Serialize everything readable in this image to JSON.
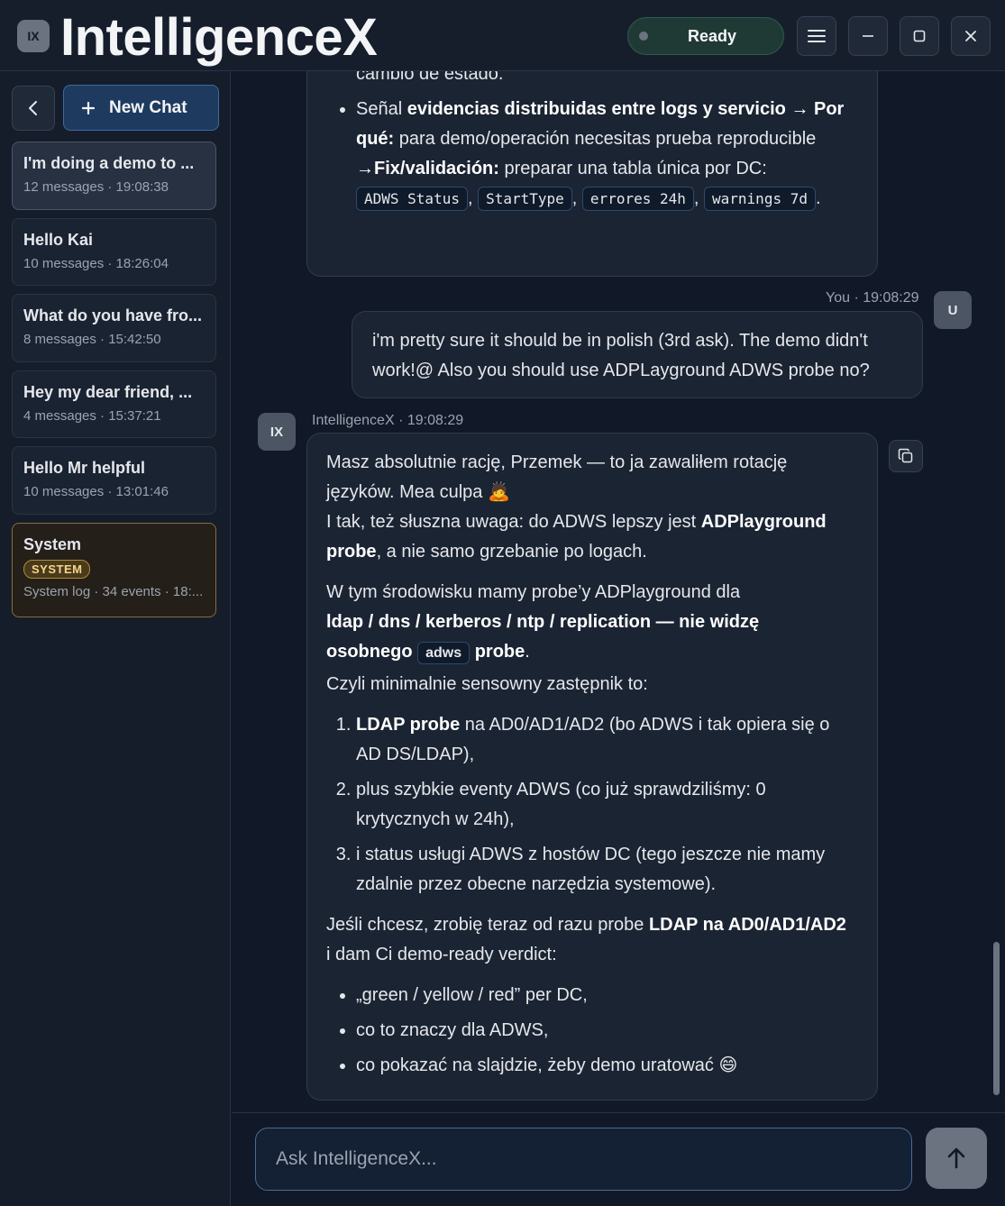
{
  "app": {
    "badge": "IX",
    "title": "IntelligenceX",
    "status": "Ready"
  },
  "sidebar": {
    "new_chat_label": "New Chat",
    "chats": [
      {
        "title": "I'm doing a demo to ...",
        "meta": "12 messages · 19:08:38"
      },
      {
        "title": "Hello Kai",
        "meta": "10 messages · 18:26:04"
      },
      {
        "title": "What do you have fro...",
        "meta": "8 messages · 15:42:50"
      },
      {
        "title": "Hey my dear friend, ...",
        "meta": "4 messages · 15:37:21"
      },
      {
        "title": "Hello Mr helpful",
        "meta": "10 messages · 13:01:46"
      },
      {
        "title": "System",
        "badge": "SYSTEM",
        "meta": "System log · 34 events · 18:..."
      }
    ]
  },
  "messages": {
    "prev_bot": {
      "line1": "min) de estado de servicio + evento ADWS y alertar en cambio de estado.",
      "bullet_pre": "Señal ",
      "bullet_b1": "evidencias distribuidas entre logs y servicio → Por qué:",
      "bullet_mid": " para demo/operación necesitas prueba reproducible ",
      "bullet_b2": "→Fix/validación:",
      "bullet_post": " preparar una tabla única por DC:",
      "codes": [
        "ADWS Status",
        "StartType",
        "errores 24h",
        "warnings 7d"
      ]
    },
    "user": {
      "avatar": "U",
      "sender": "You · 19:08:29",
      "text": "i'm pretty sure it should be in polish (3rd ask). The demo didn't work!@ Also you should use ADPLayground ADWS probe no?"
    },
    "bot": {
      "avatar": "IX",
      "sender": "IntelligenceX · 19:08:29",
      "p1_a": "Masz absolutnie rację, Przemek — to ja zawaliłem rotację języków. Mea culpa 🙇",
      "p1_b_pre": "I tak, też słuszna uwaga: do ADWS lepszy jest ",
      "p1_b_bold": "ADPlayground probe",
      "p1_b_post": ", a nie samo grzebanie po logach.",
      "p2_pre": "W tym środowisku mamy probe’y ADPlayground dla ",
      "p2_bold": "ldap / dns / kerberos / ntp / replication — nie widzę osobnego",
      "p2_code": "adws",
      "p2_bold2": "probe",
      "p2_post": ".",
      "p3": "Czyli minimalnie sensowny zastępnik to:",
      "ol": [
        {
          "bold": "LDAP probe",
          "text": " na AD0/AD1/AD2 (bo ADWS i tak opiera się o AD DS/LDAP),"
        },
        {
          "bold": "",
          "text": "plus szybkie eventy ADWS (co już sprawdziliśmy: 0 krytycznych w 24h),"
        },
        {
          "bold": "",
          "text": "i status usługi ADWS z hostów DC (tego jeszcze nie mamy zdalnie przez obecne narzędzia systemowe)."
        }
      ],
      "p4_pre": "Jeśli chcesz, zrobię teraz od razu probe ",
      "p4_bold": "LDAP na AD0/AD1/AD2",
      "p4_post": " i dam Ci demo-ready verdict:",
      "ul": [
        "„green / yellow / red” per DC,",
        "co to znaczy dla ADWS,",
        "co pokazać na slajdzie, żeby demo uratować 😄"
      ]
    }
  },
  "composer": {
    "placeholder": "Ask IntelligenceX..."
  }
}
